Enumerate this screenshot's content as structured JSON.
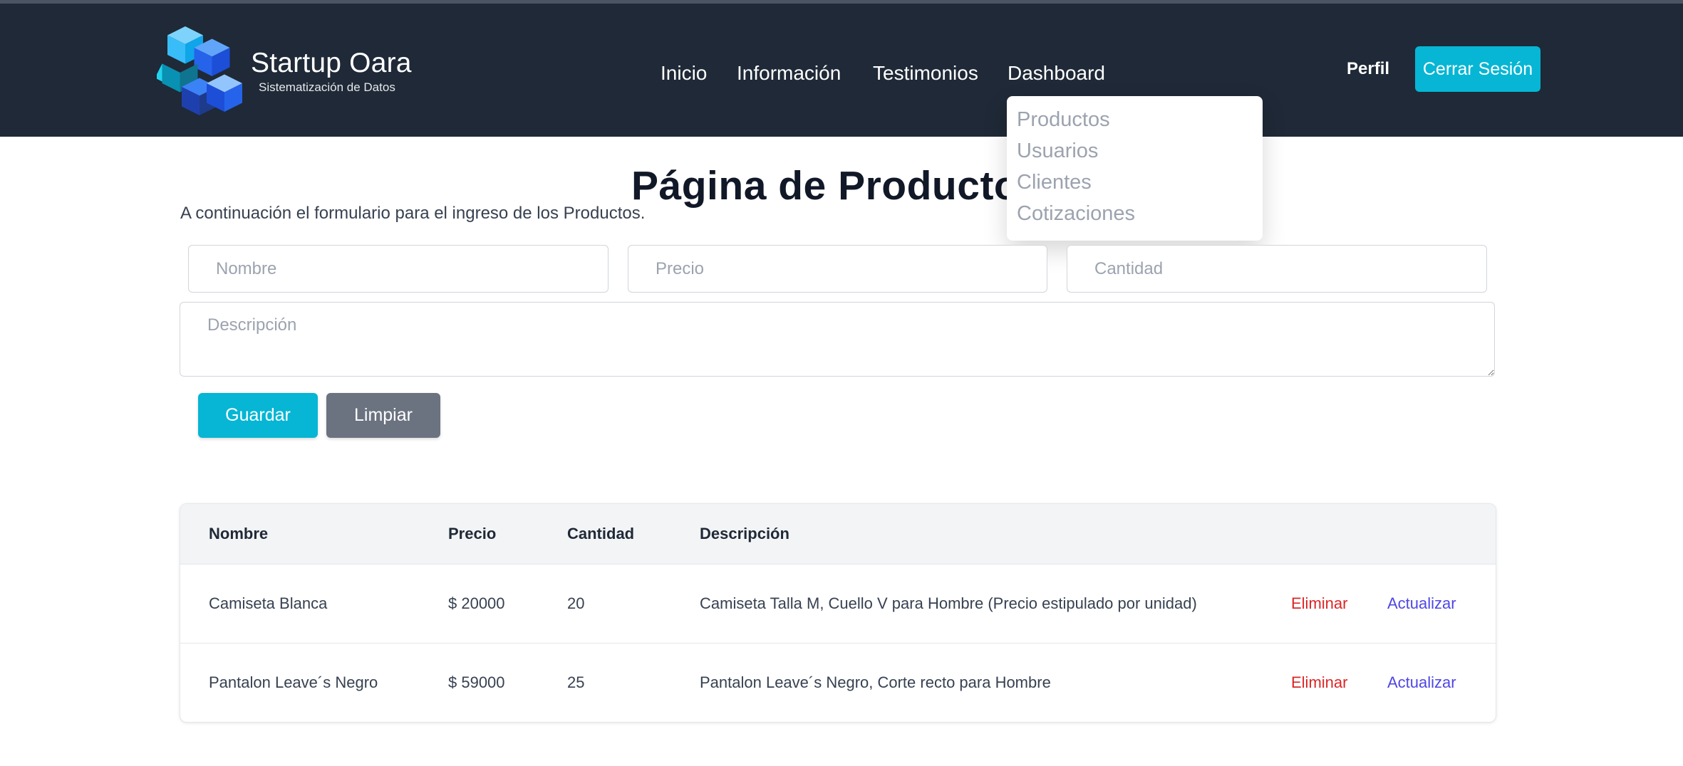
{
  "brand": {
    "title": "Startup Oara",
    "subtitle": "Sistematización de Datos",
    "logo_icon": "cube-logo-icon"
  },
  "nav": {
    "links": [
      "Inicio",
      "Información",
      "Testimonios",
      "Dashboard"
    ],
    "profile": "Perfil",
    "logout": "Cerrar Sesión"
  },
  "dropdown": {
    "items": [
      "Productos",
      "Usuarios",
      "Clientes",
      "Cotizaciones"
    ]
  },
  "page": {
    "title": "Página de Productos",
    "intro": "A continuación el formulario para el ingreso de los Productos."
  },
  "form": {
    "name_placeholder": "Nombre",
    "price_placeholder": "Precio",
    "quantity_placeholder": "Cantidad",
    "description_placeholder": "Descripción",
    "save_label": "Guardar",
    "clear_label": "Limpiar"
  },
  "table": {
    "headers": [
      "Nombre",
      "Precio",
      "Cantidad",
      "Descripción"
    ],
    "rows": [
      {
        "name": "Camiseta Blanca",
        "price": "$ 20000",
        "quantity": "20",
        "description": "Camiseta Talla M, Cuello V para Hombre (Precio estipulado por unidad)",
        "delete_label": "Eliminar",
        "update_label": "Actualizar"
      },
      {
        "name": "Pantalon Leave´s Negro",
        "price": "$ 59000",
        "quantity": "25",
        "description": "Pantalon Leave´s Negro, Corte recto para Hombre",
        "delete_label": "Eliminar",
        "update_label": "Actualizar"
      }
    ]
  },
  "colors": {
    "navbar": "#1f2937",
    "accent": "#06b6d4",
    "secondary_button": "#6b7280",
    "delete_link": "#dc2626",
    "update_link": "#4f46e5"
  }
}
